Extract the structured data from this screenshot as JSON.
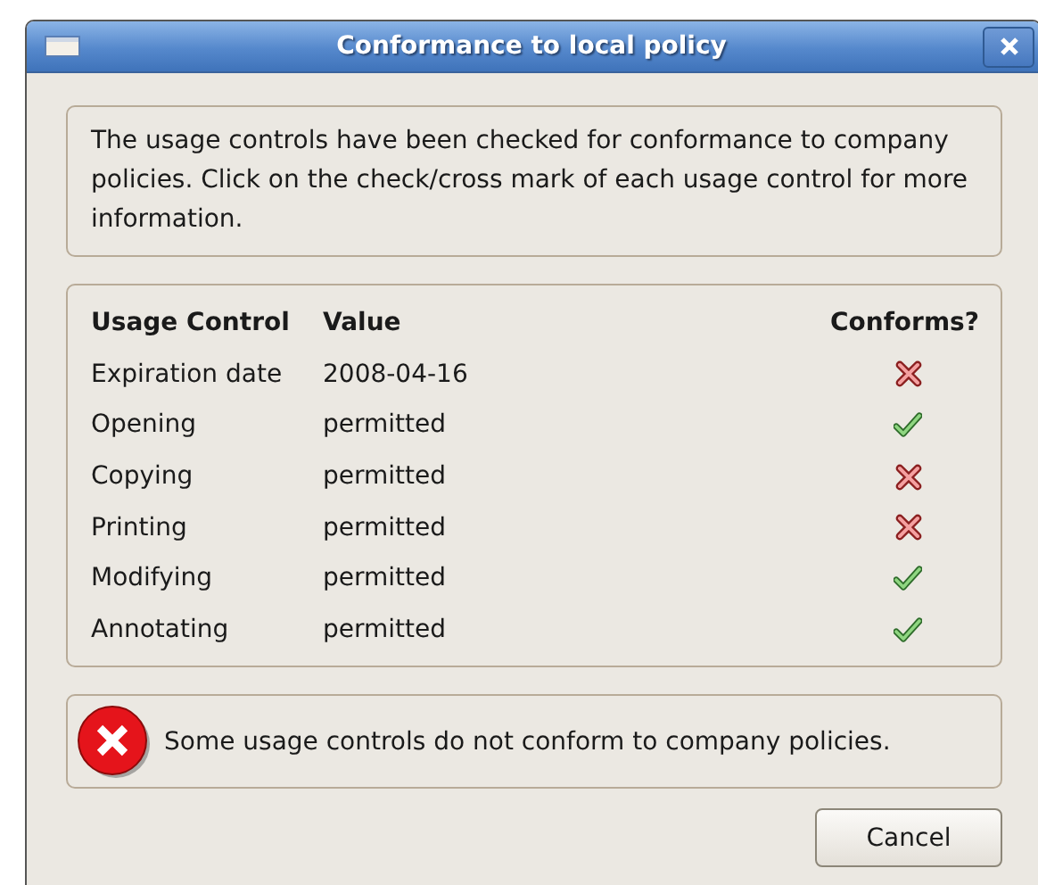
{
  "window": {
    "title": "Conformance to local policy"
  },
  "intro": "The usage controls have been checked for conformance to company policies. Click on the check/cross mark of each usage control for more information.",
  "table": {
    "columns": [
      "Usage Control",
      "Value",
      "Conforms?"
    ],
    "rows": [
      {
        "control": "Expiration date",
        "value": "2008-04-16",
        "conforms": false
      },
      {
        "control": "Opening",
        "value": "permitted",
        "conforms": true
      },
      {
        "control": "Copying",
        "value": "permitted",
        "conforms": false
      },
      {
        "control": "Printing",
        "value": "permitted",
        "conforms": false
      },
      {
        "control": "Modifying",
        "value": "permitted",
        "conforms": true
      },
      {
        "control": "Annotating",
        "value": "permitted",
        "conforms": true
      }
    ]
  },
  "status": {
    "kind": "error",
    "message": "Some usage controls do not conform to company policies."
  },
  "buttons": [
    "Cancel"
  ]
}
